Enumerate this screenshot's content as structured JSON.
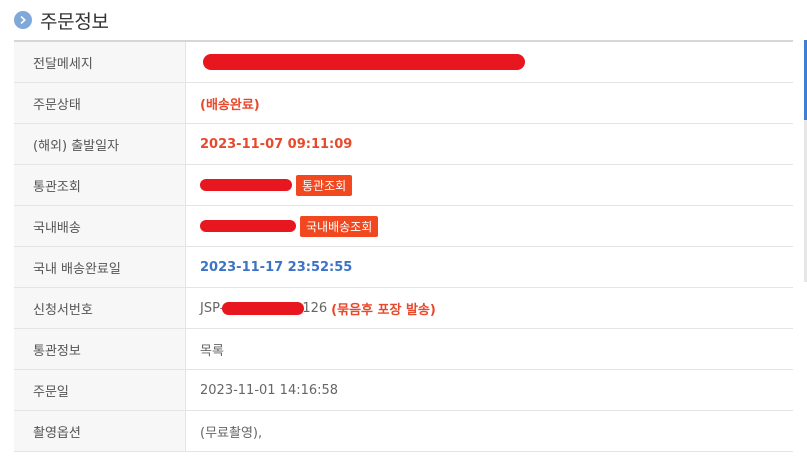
{
  "section": {
    "title": "주문정보",
    "icon": "chevron-right-icon"
  },
  "rows": [
    {
      "label": "전달메세지",
      "value": ""
    },
    {
      "label": "주문상태",
      "value": "(배송완료)"
    },
    {
      "label": "(해외) 출발일자",
      "value": "2023-11-07 09:11:09"
    },
    {
      "label": "통관조회",
      "button": "통관조회"
    },
    {
      "label": "국내배송",
      "button": "국내배송조회"
    },
    {
      "label": "국내 배송완료일",
      "value": "2023-11-17 23:52:55"
    },
    {
      "label": "신청서번호",
      "prefix": "JSP-",
      "suffix": "126",
      "note": "(묶음후 포장 발송)"
    },
    {
      "label": "통관정보",
      "value": "목록"
    },
    {
      "label": "주문일",
      "value": "2023-11-01 14:16:58"
    },
    {
      "label": "촬영옵션",
      "value": "(무료촬영),"
    }
  ],
  "colors": {
    "accent_orange": "#e8492c",
    "accent_blue": "#3c73c5",
    "button_bg": "#f2481f",
    "redaction": "#e8161e"
  }
}
